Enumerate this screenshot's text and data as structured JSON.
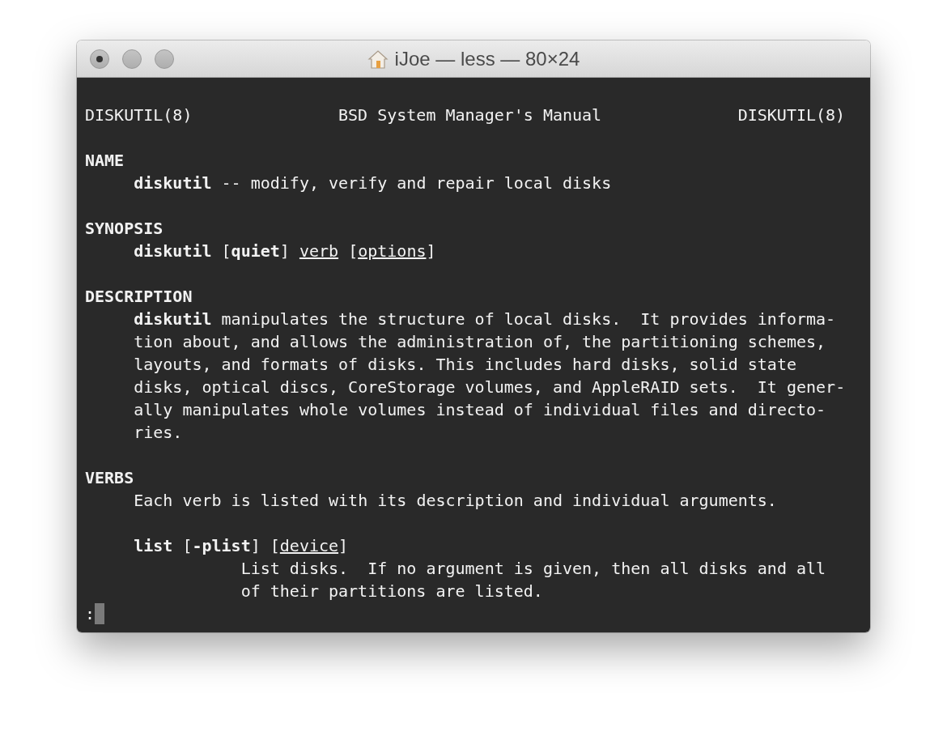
{
  "window": {
    "title": "iJoe — less — 80×24"
  },
  "header": {
    "left": "DISKUTIL(8)",
    "center": "BSD System Manager's Manual",
    "right": "DISKUTIL(8)"
  },
  "lines": [
    {
      "kind": "blank"
    },
    {
      "kind": "heading",
      "segments": [
        {
          "text": "NAME",
          "kind": "keyword"
        }
      ]
    },
    {
      "kind": "body",
      "segments": [
        {
          "text": "diskutil",
          "kind": "keyword"
        },
        {
          "text": " -- modify, verify and repair local disks",
          "kind": "prose"
        }
      ]
    },
    {
      "kind": "blank"
    },
    {
      "kind": "heading",
      "segments": [
        {
          "text": "SYNOPSIS",
          "kind": "keyword"
        }
      ]
    },
    {
      "kind": "body",
      "segments": [
        {
          "text": "diskutil",
          "kind": "keyword"
        },
        {
          "text": " [",
          "kind": "prose"
        },
        {
          "text": "quiet",
          "kind": "keyword"
        },
        {
          "text": "] ",
          "kind": "prose"
        },
        {
          "text": "verb",
          "kind": "parameter"
        },
        {
          "text": " [",
          "kind": "prose"
        },
        {
          "text": "options",
          "kind": "parameter"
        },
        {
          "text": "]",
          "kind": "prose"
        }
      ]
    },
    {
      "kind": "blank"
    },
    {
      "kind": "heading",
      "segments": [
        {
          "text": "DESCRIPTION",
          "kind": "keyword"
        }
      ]
    },
    {
      "kind": "body",
      "segments": [
        {
          "text": "diskutil",
          "kind": "keyword"
        },
        {
          "text": " manipulates the structure of local disks.  It provides informa-",
          "kind": "prose"
        }
      ]
    },
    {
      "kind": "body",
      "segments": [
        {
          "text": "tion about, and allows the administration of, the partitioning schemes,",
          "kind": "prose"
        }
      ]
    },
    {
      "kind": "body",
      "segments": [
        {
          "text": "layouts, and formats of disks. This includes hard disks, solid state",
          "kind": "prose"
        }
      ]
    },
    {
      "kind": "body",
      "segments": [
        {
          "text": "disks, optical discs, CoreStorage volumes, and AppleRAID sets.  It gener-",
          "kind": "prose"
        }
      ]
    },
    {
      "kind": "body",
      "segments": [
        {
          "text": "ally manipulates whole volumes instead of individual files and directo-",
          "kind": "prose"
        }
      ]
    },
    {
      "kind": "body",
      "segments": [
        {
          "text": "ries.",
          "kind": "prose"
        }
      ]
    },
    {
      "kind": "blank"
    },
    {
      "kind": "heading",
      "segments": [
        {
          "text": "VERBS",
          "kind": "keyword"
        }
      ]
    },
    {
      "kind": "body",
      "segments": [
        {
          "text": "Each verb is listed with its description and individual arguments.",
          "kind": "prose"
        }
      ]
    },
    {
      "kind": "blank"
    },
    {
      "kind": "body",
      "segments": [
        {
          "text": "list",
          "kind": "keyword"
        },
        {
          "text": " [",
          "kind": "prose"
        },
        {
          "text": "-plist",
          "kind": "keyword"
        },
        {
          "text": "] [",
          "kind": "prose"
        },
        {
          "text": "device",
          "kind": "parameter"
        },
        {
          "text": "]",
          "kind": "prose"
        }
      ]
    },
    {
      "kind": "detail",
      "segments": [
        {
          "text": "List disks.  If no argument is given, then all disks and all",
          "kind": "prose"
        }
      ]
    },
    {
      "kind": "detail",
      "segments": [
        {
          "text": "of their partitions are listed.",
          "kind": "prose"
        }
      ]
    }
  ],
  "prompt": {
    "text": ":"
  }
}
